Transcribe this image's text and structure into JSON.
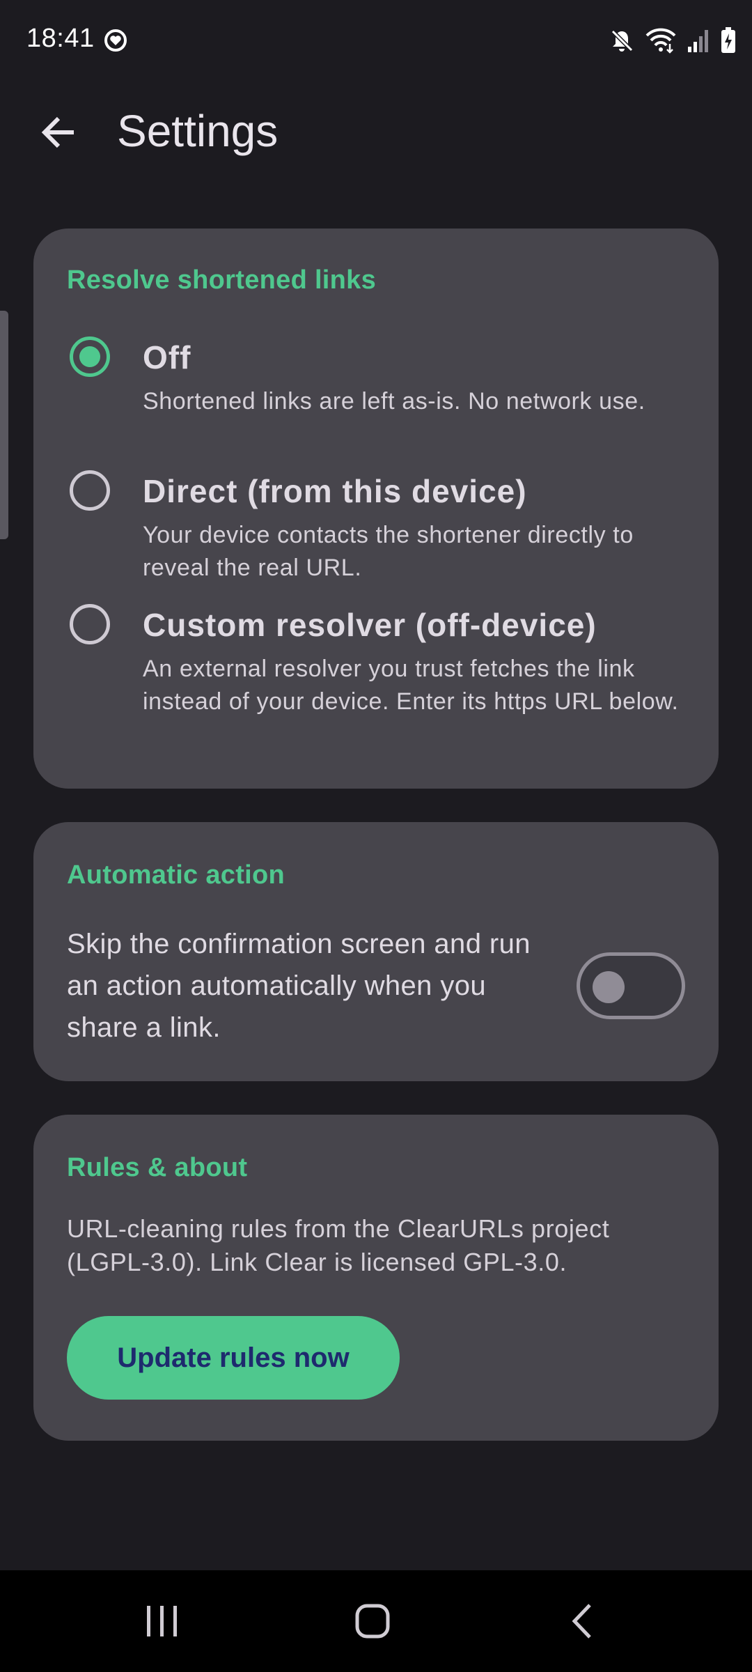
{
  "status_bar": {
    "time": "18:41",
    "app_icon": "heart-in-circle-icon",
    "icons": [
      "mute-icon",
      "wifi-icon",
      "signal-icon",
      "battery-charging-icon"
    ]
  },
  "app_bar": {
    "title": "Settings",
    "back_icon": "arrow-left-icon"
  },
  "resolve_card": {
    "title": "Resolve shortened links",
    "selected": "off",
    "options": [
      {
        "id": "off",
        "label": "Off",
        "description": "Shortened links are left as-is. No network use."
      },
      {
        "id": "direct",
        "label": "Direct (from this device)",
        "description": "Your device contacts the shortener directly to reveal the real URL."
      },
      {
        "id": "custom",
        "label": "Custom resolver (off-device)",
        "description": "An external resolver you trust fetches the link instead of your device. Enter its https URL below."
      }
    ]
  },
  "automatic_card": {
    "title": "Automatic action",
    "description": "Skip the confirmation screen and run an action automatically when you share a link.",
    "switch_on": false
  },
  "rules_card": {
    "title": "Rules & about",
    "description": "URL-cleaning rules from the ClearURLs project (LGPL-3.0). Link Clear is licensed GPL-3.0.",
    "button_label": "Update rules now"
  },
  "nav_bar": {
    "buttons": [
      "recent-apps-icon",
      "home-icon",
      "back-icon"
    ]
  },
  "colors": {
    "accent": "#4fc88e",
    "background": "#1c1b20",
    "card": "#47454c",
    "button_text": "#1e2a6e"
  }
}
